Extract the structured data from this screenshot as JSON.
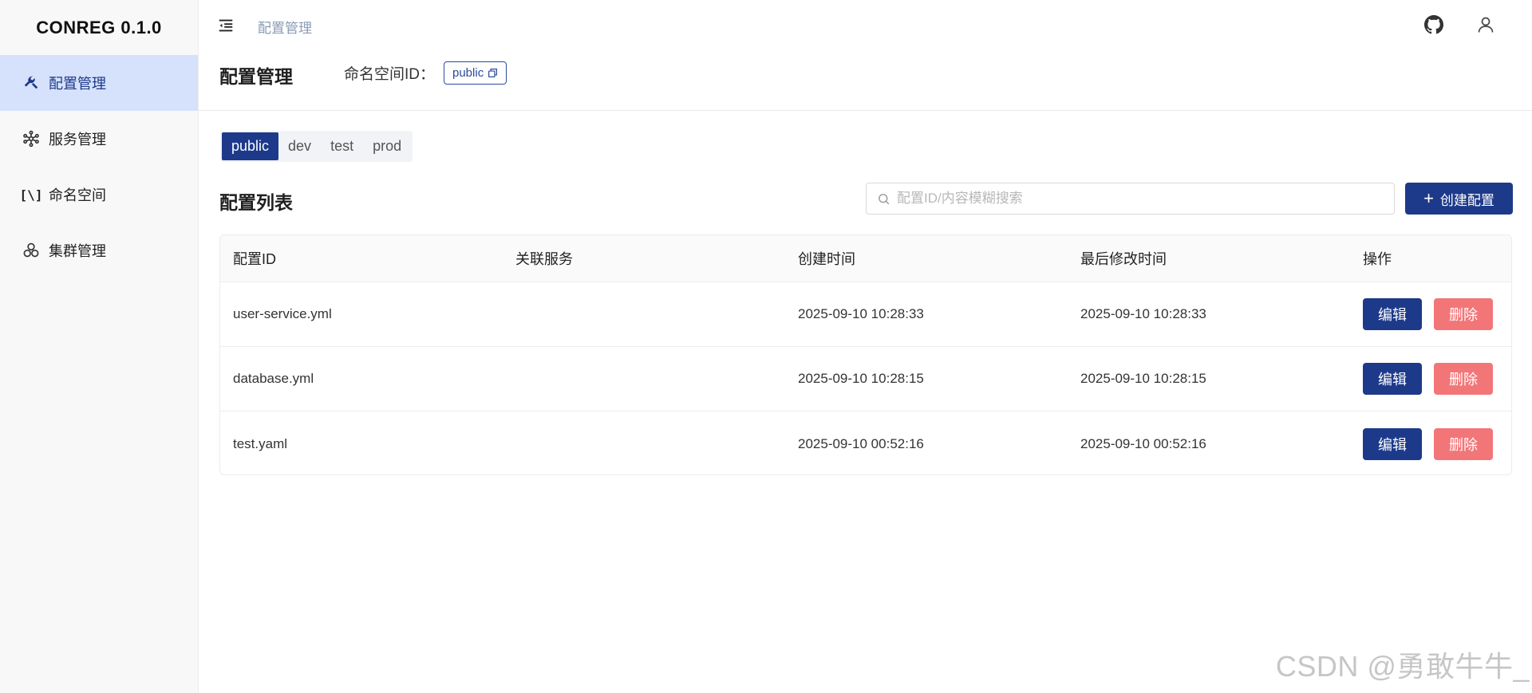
{
  "app": {
    "logo": "CONREG 0.1.0"
  },
  "sidebar": {
    "items": [
      {
        "label": "配置管理",
        "icon": "tools-icon",
        "active": true
      },
      {
        "label": "服务管理",
        "icon": "network-icon"
      },
      {
        "label": "命名空间",
        "icon": "namespace-icon"
      },
      {
        "label": "集群管理",
        "icon": "cluster-icon"
      }
    ]
  },
  "topbar": {
    "breadcrumb": "配置管理",
    "icons": [
      "menu-fold-icon",
      "github-icon",
      "user-icon"
    ]
  },
  "header": {
    "title": "配置管理",
    "namespace_label": "命名空间ID：",
    "namespace_value": "public"
  },
  "env_tabs": [
    {
      "label": "public",
      "active": true
    },
    {
      "label": "dev"
    },
    {
      "label": "test"
    },
    {
      "label": "prod"
    }
  ],
  "list": {
    "title": "配置列表",
    "search_placeholder": "配置ID/内容模糊搜索",
    "create_label": "创建配置"
  },
  "table": {
    "columns": [
      "配置ID",
      "关联服务",
      "创建时间",
      "最后修改时间",
      "操作"
    ],
    "rows": [
      {
        "id": "user-service.yml",
        "service": "",
        "created": "2025-09-10 10:28:33",
        "modified": "2025-09-10 10:28:33"
      },
      {
        "id": "database.yml",
        "service": "",
        "created": "2025-09-10 10:28:15",
        "modified": "2025-09-10 10:28:15"
      },
      {
        "id": "test.yaml",
        "service": "",
        "created": "2025-09-10 00:52:16",
        "modified": "2025-09-10 00:52:16"
      }
    ],
    "edit_label": "编辑",
    "delete_label": "删除"
  },
  "watermark": "CSDN @勇敢牛牛_",
  "colors": {
    "primary": "#1d3a8a",
    "danger": "#f27678",
    "sidebar_active_bg": "#d6e1fb",
    "breadcrumb": "#8a9bb5"
  }
}
